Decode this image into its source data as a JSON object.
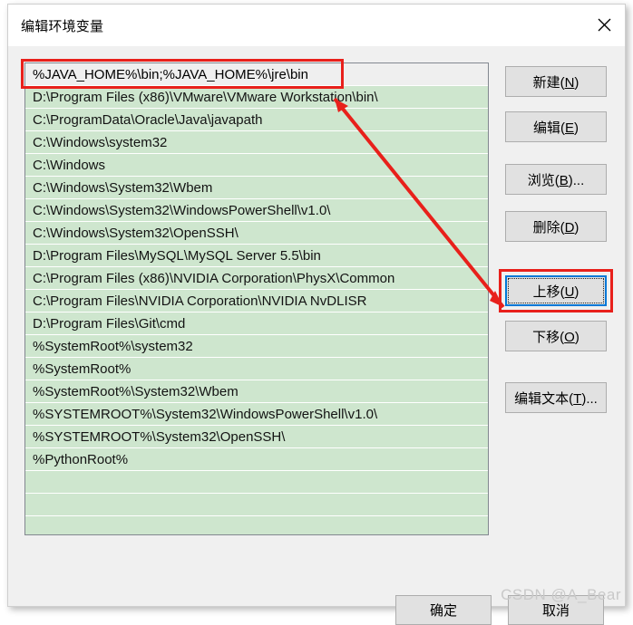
{
  "window": {
    "title": "编辑环境变量",
    "close_icon": "close-icon"
  },
  "list": {
    "selected_index": 0,
    "items": [
      "%JAVA_HOME%\\bin;%JAVA_HOME%\\jre\\bin",
      "D:\\Program Files (x86)\\VMware\\VMware Workstation\\bin\\",
      "C:\\ProgramData\\Oracle\\Java\\javapath",
      "C:\\Windows\\system32",
      "C:\\Windows",
      "C:\\Windows\\System32\\Wbem",
      "C:\\Windows\\System32\\WindowsPowerShell\\v1.0\\",
      "C:\\Windows\\System32\\OpenSSH\\",
      "D:\\Program Files\\MySQL\\MySQL Server 5.5\\bin",
      "C:\\Program Files (x86)\\NVIDIA Corporation\\PhysX\\Common",
      "C:\\Program Files\\NVIDIA Corporation\\NVIDIA NvDLISR",
      "D:\\Program Files\\Git\\cmd",
      "%SystemRoot%\\system32",
      "%SystemRoot%",
      "%SystemRoot%\\System32\\Wbem",
      "%SYSTEMROOT%\\System32\\WindowsPowerShell\\v1.0\\",
      "%SYSTEMROOT%\\System32\\OpenSSH\\",
      "%PythonRoot%",
      "",
      "",
      "",
      ""
    ]
  },
  "side_buttons": {
    "new": "新建(N)",
    "edit": "编辑(E)",
    "browse": "浏览(B)...",
    "delete": "删除(D)",
    "move_up": "上移(U)",
    "move_down": "下移(O)",
    "edit_text": "编辑文本(T)..."
  },
  "footer": {
    "ok": "确定",
    "cancel": "取消"
  },
  "annotations": {
    "highlight_color": "#e8201b",
    "focus_color": "#0078d7",
    "arrow_from": "first-list-row",
    "arrow_to": "move-up-button"
  },
  "watermark": {
    "text": "CSDN @A_Bear"
  }
}
